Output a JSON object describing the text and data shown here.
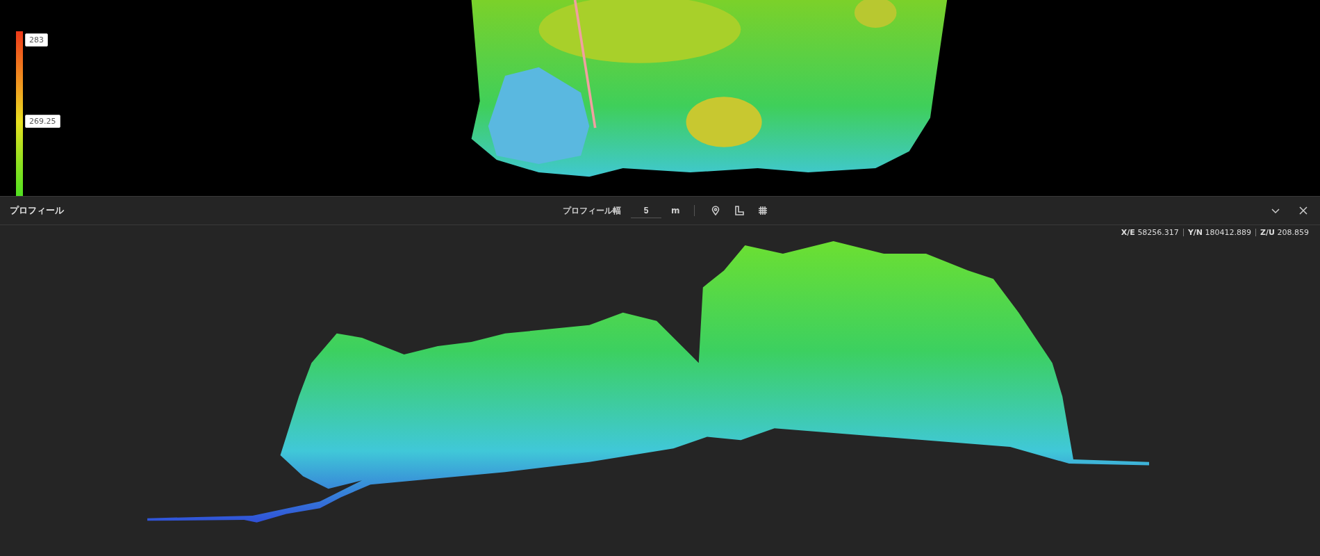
{
  "legend": {
    "labels": [
      "283",
      "269.25"
    ]
  },
  "panel": {
    "title": "プロフィール",
    "width_label": "プロフィール幅",
    "width_value": "5",
    "width_unit": "m"
  },
  "coordinates": [
    {
      "axis": "X/E",
      "value": "58256.317"
    },
    {
      "axis": "Y/N",
      "value": "180412.889"
    },
    {
      "axis": "Z/U",
      "value": "208.859"
    }
  ]
}
